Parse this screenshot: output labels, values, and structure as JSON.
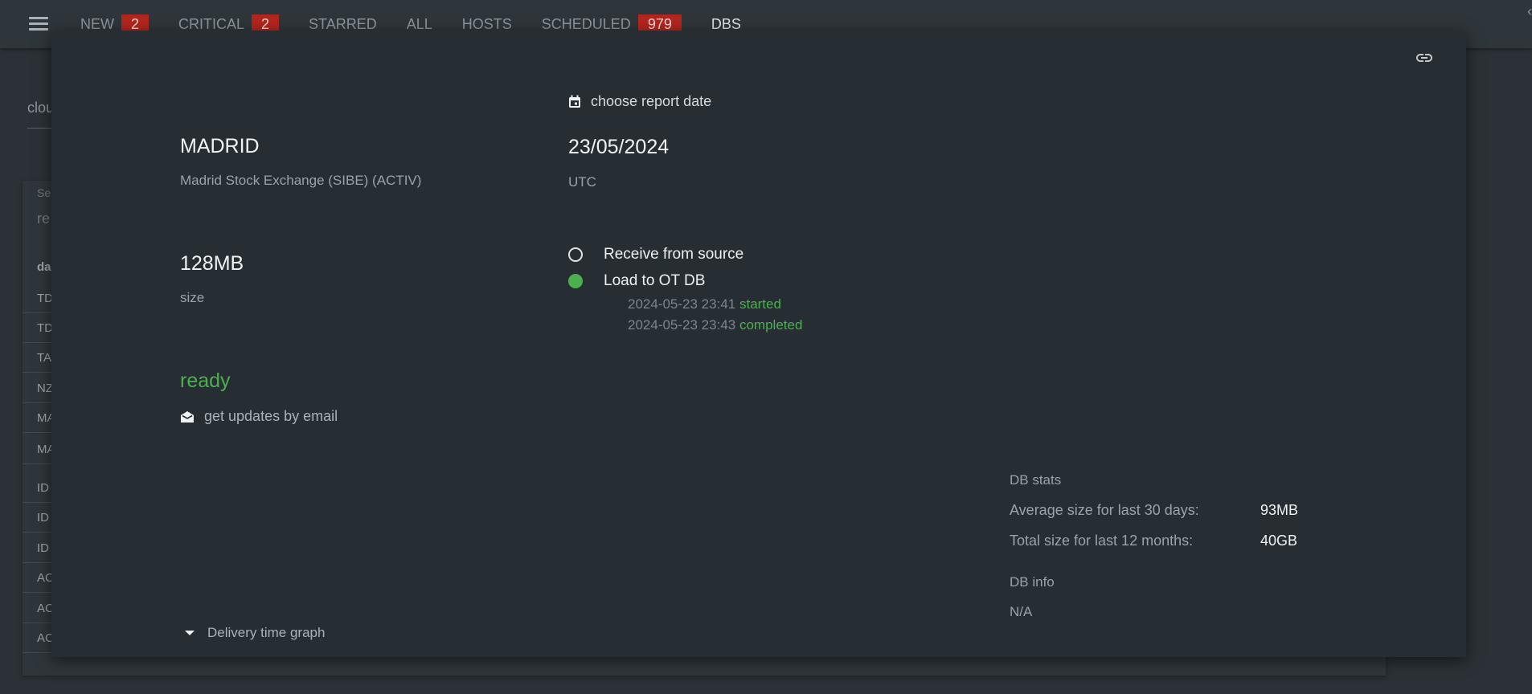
{
  "nav": {
    "tabs": [
      {
        "label": "NEW",
        "badge": "2"
      },
      {
        "label": "CRITICAL",
        "badge": "2"
      },
      {
        "label": "STARRED",
        "badge": null
      },
      {
        "label": "ALL",
        "badge": null
      },
      {
        "label": "HOSTS",
        "badge": null
      },
      {
        "label": "SCHEDULED",
        "badge": "979"
      },
      {
        "label": "DBS",
        "badge": null
      }
    ],
    "active_tab": "DBS"
  },
  "background": {
    "search_text": "clou",
    "filter_label": "Se",
    "filter_value": "re",
    "column_header": "da",
    "rows": [
      "TD",
      "TD",
      "TA",
      "NZ",
      "MA",
      "MA",
      "ID",
      "ID",
      "ID",
      "AC",
      "AC",
      "AC"
    ]
  },
  "modal": {
    "date_picker_label": "choose report date",
    "name": "MADRID",
    "description": "Madrid Stock Exchange (SIBE) (ACTIV)",
    "date": "23/05/2024",
    "timezone": "UTC",
    "size_value": "128MB",
    "size_label": "size",
    "status": "ready",
    "email_label": "get updates by email",
    "steps": [
      {
        "label": "Receive from source",
        "done": false
      },
      {
        "label": "Load to OT DB",
        "done": true
      }
    ],
    "log": [
      {
        "time": "2024-05-23 23:41",
        "status": "started"
      },
      {
        "time": "2024-05-23 23:43",
        "status": "completed"
      }
    ],
    "db_stats": {
      "title": "DB stats",
      "avg_label": "Average size for last 30 days:",
      "avg_value": "93MB",
      "total_label": "Total size for last 12 months:",
      "total_value": "40GB"
    },
    "db_info": {
      "title": "DB info",
      "value": "N/A"
    },
    "graph_toggle_label": "Delivery time graph"
  },
  "colors": {
    "accent_green": "#4caf50",
    "badge_red": "#b3261e",
    "modal_bg": "#262e33"
  }
}
